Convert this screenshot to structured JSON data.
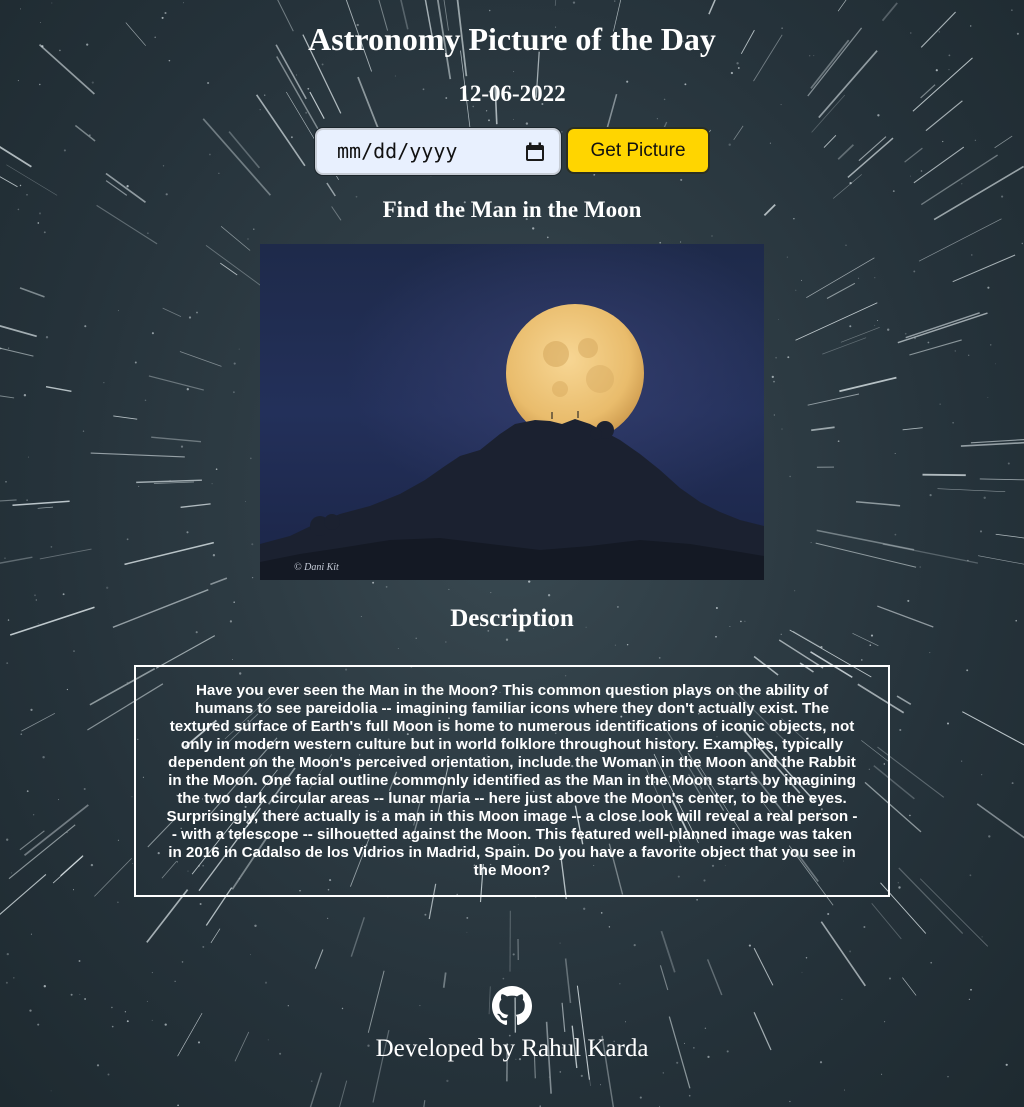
{
  "page": {
    "title": "Astronomy Picture of the Day",
    "date": "12-06-2022"
  },
  "controls": {
    "date_placeholder": "mm/dd/yyyy",
    "get_button_label": "Get Picture",
    "button_color": "#ffd500"
  },
  "picture": {
    "title": "Find the Man in the Moon",
    "watermark": "© Dani Kit"
  },
  "description": {
    "heading": "Description",
    "text": "Have you ever seen the Man in the Moon? This common question plays on the ability of humans to see pareidolia -- imagining familiar icons where they don't actually exist. The textured surface of Earth's full Moon is home to numerous identifications of iconic objects, not only in modern western culture but in world folklore throughout history. Examples, typically dependent on the Moon's perceived orientation, include the Woman in the Moon and the Rabbit in the Moon. One facial outline commonly identified as the Man in the Moon starts by imagining the two dark circular areas -- lunar maria -- here just above the Moon's center, to be the eyes. Surprisingly, there actually is a man in this Moon image -- a close look will reveal a real person -- with a telescope -- silhouetted against the Moon. This featured well-planned image was taken in 2016 in Cadalso de los Vidrios in Madrid, Spain. Do you have a favorite object that you see in the Moon?"
  },
  "footer": {
    "prefix": "Developed by ",
    "author": "Rahul Karda",
    "icon": "github-icon"
  }
}
